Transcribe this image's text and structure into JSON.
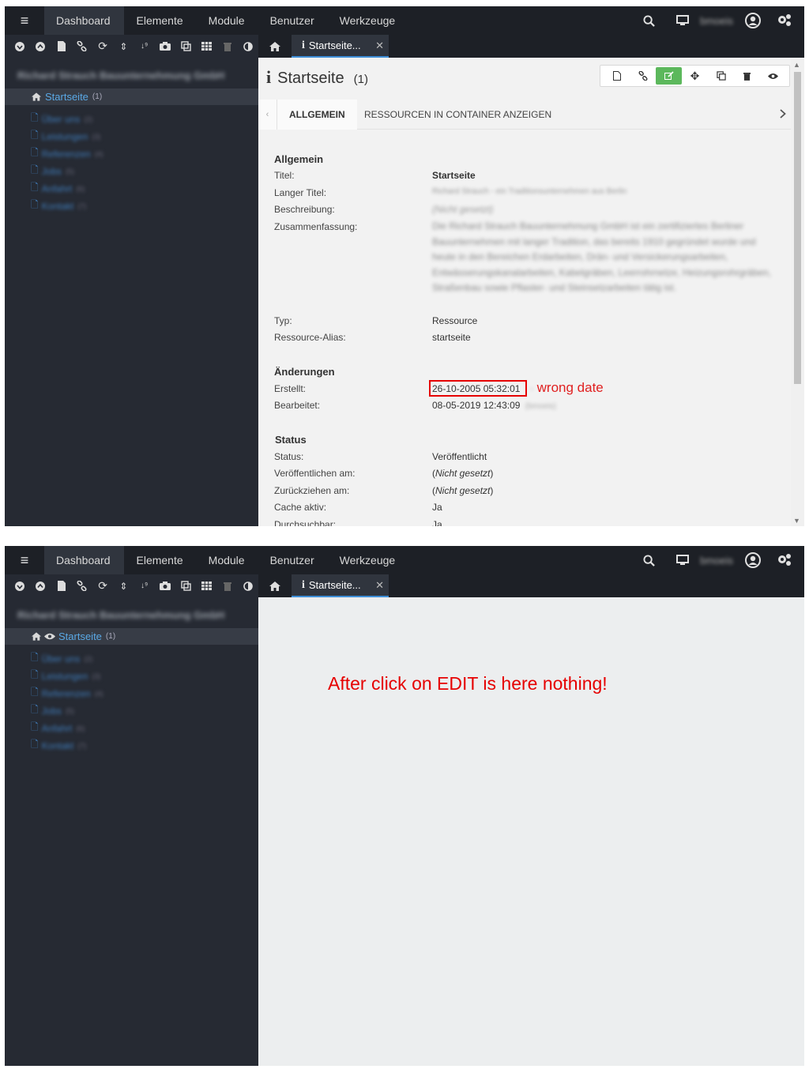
{
  "topnav": {
    "items": [
      "Dashboard",
      "Elemente",
      "Module",
      "Benutzer",
      "Werkzeuge"
    ],
    "active": "Dashboard",
    "username": "bmoeis"
  },
  "tree": {
    "site_name": "Richard Strauch Bauunternehmung GmbH",
    "active_node": {
      "label": "Startseite",
      "count": "(1)"
    },
    "children": [
      {
        "label": "Über uns",
        "count": "(2)"
      },
      {
        "label": "Leistungen",
        "count": "(3)"
      },
      {
        "label": "Referenzen",
        "count": "(4)"
      },
      {
        "label": "Jobs",
        "count": "(5)"
      },
      {
        "label": "Anfahrt",
        "count": "(6)"
      },
      {
        "label": "Kontakt",
        "count": "(7)"
      }
    ]
  },
  "tab": {
    "label": "Startseite..."
  },
  "page": {
    "title": "Startseite",
    "count": "(1)"
  },
  "content_tabs": [
    "ALLGEMEIN",
    "RESSOURCEN IN CONTAINER ANZEIGEN"
  ],
  "sections": {
    "allgemein": {
      "heading": "Allgemein",
      "titel_label": "Titel:",
      "titel_value": "Startseite",
      "langer_titel_label": "Langer Titel:",
      "langer_titel_value": "Richard Strauch - ein Traditionsunternehmen aus Berlin",
      "beschreibung_label": "Beschreibung:",
      "beschreibung_value": "(Nicht gesetzt)",
      "zusammenfassung_label": "Zusammenfassung:",
      "zusammenfassung_value": "Die Richard Strauch Bauunternehmung GmbH ist ein zertifiziertes Berliner Bauunternehmen mit langer Tradition, das bereits 1910 gegründet wurde und heute in den Bereichen Erdarbeiten, Drän- und Versickerungsarbeiten, Entwässerungskanalarbeiten, Kabelgräben, Leerrohrnetze, Heizungsrohrgräben, Straßenbau sowie Pflaster- und Steinsetzarbeiten tätig ist.",
      "typ_label": "Typ:",
      "typ_value": "Ressource",
      "alias_label": "Ressource-Alias:",
      "alias_value": "startseite"
    },
    "aenderungen": {
      "heading": "Änderungen",
      "erstellt_label": "Erstellt:",
      "erstellt_value": "26-10-2005 05:32:01",
      "bearbeitet_label": "Bearbeitet:",
      "bearbeitet_value": "08-05-2019 12:43:09",
      "bearbeitet_user": "(bmoeis)"
    },
    "status": {
      "heading": "Status",
      "status_label": "Status:",
      "status_value": "Veröffentlicht",
      "pub_label": "Veröffentlichen am:",
      "pub_value": "Nicht gesetzt",
      "unpub_label": "Zurückziehen am:",
      "unpub_value": "Nicht gesetzt",
      "cache_label": "Cache aktiv:",
      "cache_value": "Ja",
      "search_label": "Durchsuchbar:",
      "search_value": "Ja"
    }
  },
  "annotations": {
    "wrong_date": "wrong date",
    "after_edit": "After click on EDIT is here nothing!"
  },
  "icons": {
    "menu": "hamburger-icon",
    "search": "search-icon",
    "monitor": "monitor-icon",
    "user": "user-circle-icon",
    "settings": "gears-icon"
  }
}
